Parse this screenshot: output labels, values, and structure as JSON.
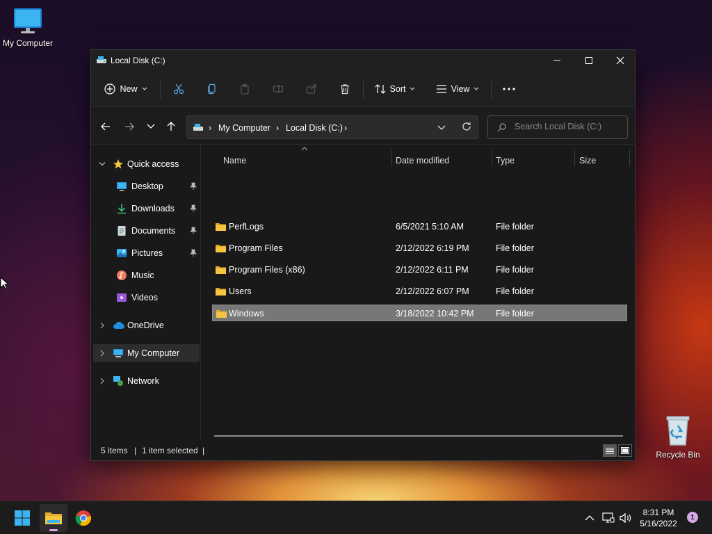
{
  "desktop": {
    "my_computer_label": "My Computer",
    "recycle_bin_label": "Recycle Bin"
  },
  "window": {
    "title": "Local Disk (C:)"
  },
  "toolbar": {
    "new_label": "New",
    "sort_label": "Sort",
    "view_label": "View"
  },
  "address": {
    "crumbs": [
      "My Computer",
      "Local Disk (C:)"
    ]
  },
  "search": {
    "placeholder": "Search Local Disk (C:)"
  },
  "sidebar": {
    "quick_access": "Quick access",
    "items": [
      {
        "label": "Desktop",
        "icon": "desktop-icon",
        "pinned": true
      },
      {
        "label": "Downloads",
        "icon": "download-icon",
        "pinned": true
      },
      {
        "label": "Documents",
        "icon": "document-icon",
        "pinned": true
      },
      {
        "label": "Pictures",
        "icon": "picture-icon",
        "pinned": true
      },
      {
        "label": "Music",
        "icon": "music-icon",
        "pinned": false
      },
      {
        "label": "Videos",
        "icon": "video-icon",
        "pinned": false
      }
    ],
    "onedrive": "OneDrive",
    "my_computer": "My Computer",
    "network": "Network"
  },
  "columns": {
    "name": "Name",
    "date": "Date modified",
    "type": "Type",
    "size": "Size"
  },
  "files": [
    {
      "name": "PerfLogs",
      "date": "6/5/2021 5:10 AM",
      "type": "File folder"
    },
    {
      "name": "Program Files",
      "date": "2/12/2022 6:19 PM",
      "type": "File folder"
    },
    {
      "name": "Program Files (x86)",
      "date": "2/12/2022 6:11 PM",
      "type": "File folder"
    },
    {
      "name": "Users",
      "date": "2/12/2022 6:07 PM",
      "type": "File folder"
    },
    {
      "name": "Windows",
      "date": "3/18/2022 10:42 PM",
      "type": "File folder",
      "selected": true
    }
  ],
  "status": {
    "items": "5 items",
    "selected": "1 item selected"
  },
  "taskbar": {
    "time": "8:31 PM",
    "date": "5/16/2022",
    "notification_count": "1"
  },
  "colors": {
    "accent": "#4cc2ff",
    "folder": "#f5c542",
    "selection": "#777777"
  }
}
